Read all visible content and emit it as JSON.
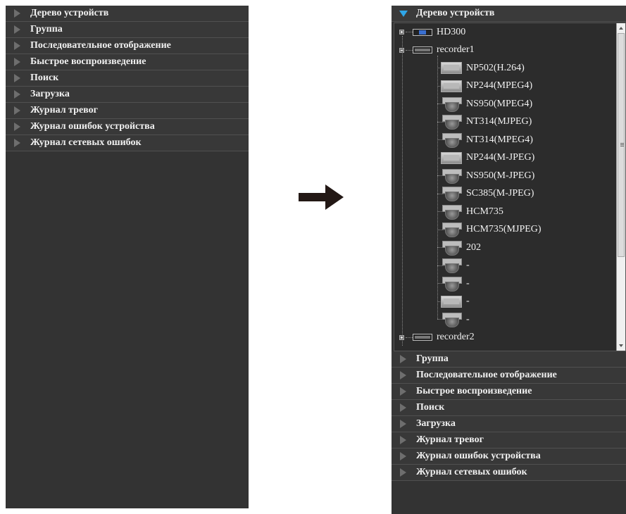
{
  "left_panel": {
    "items": [
      "Дерево устройств",
      "Группа",
      "Последовательное отображение",
      "Быстрое воспроизведение",
      "Поиск",
      "Загрузка",
      "Журнал тревог",
      "Журнал ошибок устройства",
      "Журнал сетевых ошибок"
    ]
  },
  "right_panel": {
    "open_header": "Дерево устройств",
    "tree": {
      "devices": [
        {
          "name": "HD300",
          "icon": "encoder-device-icon",
          "expanded": false
        },
        {
          "name": "recorder1",
          "icon": "recorder-device-icon",
          "expanded": true
        },
        {
          "name": "recorder2",
          "icon": "recorder-device-icon",
          "expanded": false
        }
      ],
      "cameras": [
        {
          "name": "NP502(H.264)",
          "icon": "box-camera-icon"
        },
        {
          "name": "NP244(MPEG4)",
          "icon": "box-camera-icon"
        },
        {
          "name": "NS950(MPEG4)",
          "icon": "dome-camera-icon"
        },
        {
          "name": "NT314(MJPEG)",
          "icon": "dome-camera-icon"
        },
        {
          "name": "NT314(MPEG4)",
          "icon": "dome-camera-icon"
        },
        {
          "name": "NP244(M-JPEG)",
          "icon": "box-camera-icon"
        },
        {
          "name": "NS950(M-JPEG)",
          "icon": "dome-camera-icon"
        },
        {
          "name": "SC385(M-JPEG)",
          "icon": "dome-camera-icon"
        },
        {
          "name": "HCM735",
          "icon": "dome-camera-icon"
        },
        {
          "name": "HCM735(MJPEG)",
          "icon": "dome-camera-icon"
        },
        {
          "name": "202",
          "icon": "dome-camera-icon"
        },
        {
          "name": "-",
          "icon": "dome-camera-icon"
        },
        {
          "name": "-",
          "icon": "dome-camera-icon"
        },
        {
          "name": "-",
          "icon": "box-camera-icon"
        },
        {
          "name": "-",
          "icon": "dome-camera-icon"
        }
      ]
    },
    "items": [
      "Группа",
      "Последовательное отображение",
      "Быстрое воспроизведение",
      "Поиск",
      "Загрузка",
      "Журнал тревог",
      "Журнал ошибок устройства",
      "Журнал сетевых ошибок"
    ]
  },
  "colors": {
    "panel_bg": "#333333",
    "open_triangle": "#2fa6e8",
    "closed_triangle": "#6e6e6e",
    "text": "#f0f0f0"
  }
}
